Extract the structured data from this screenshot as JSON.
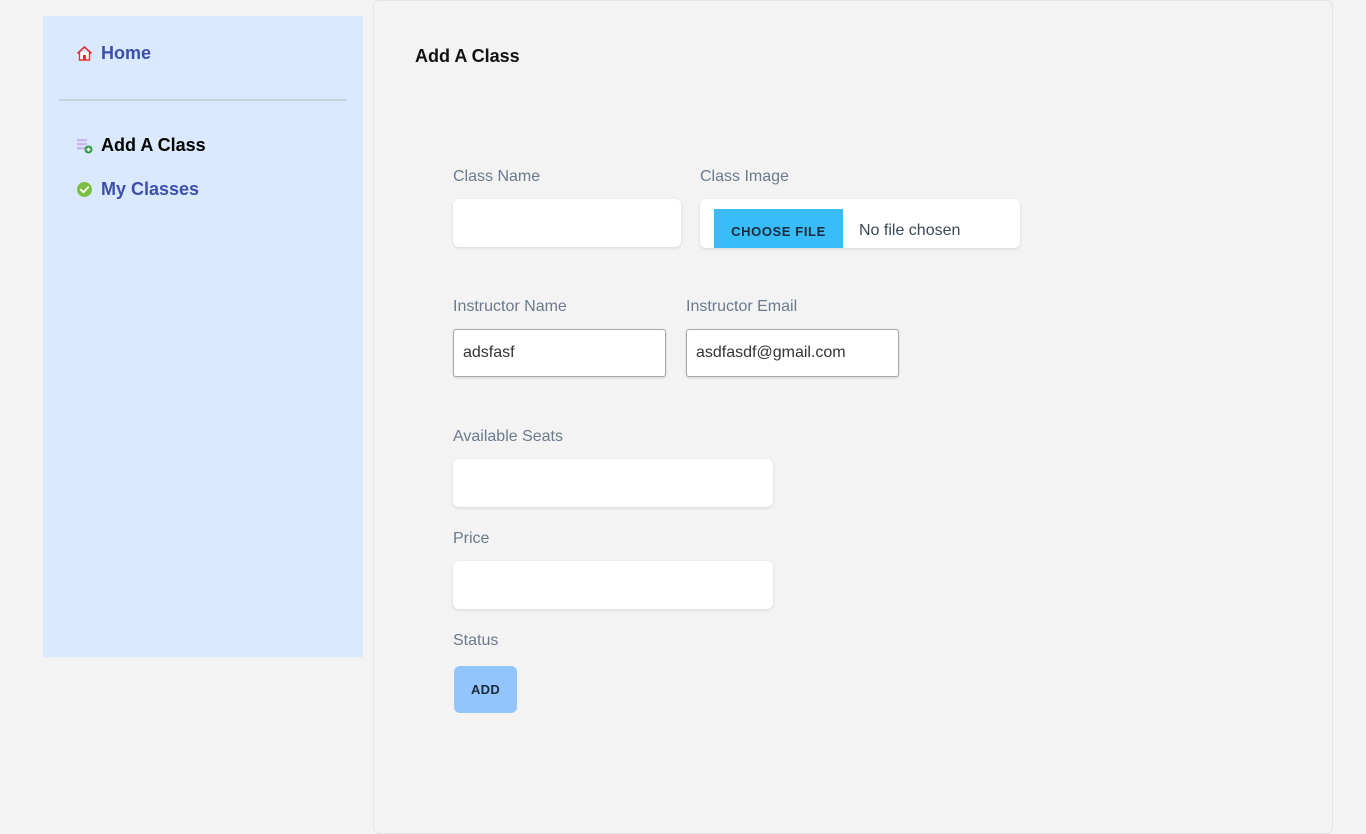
{
  "sidebar": {
    "home_label": "Home",
    "items": [
      {
        "label": "Add A Class",
        "icon": "add-list-icon"
      },
      {
        "label": "My Classes",
        "icon": "check-circle-icon"
      }
    ]
  },
  "form": {
    "title": "Add A Class",
    "class_name": {
      "label": "Class Name",
      "value": ""
    },
    "class_image": {
      "label": "Class Image",
      "button_label": "CHOOSE FILE",
      "status": "No file chosen"
    },
    "instructor_name": {
      "label": "Instructor Name",
      "value": "adsfasf"
    },
    "instructor_email": {
      "label": "Instructor Email",
      "value": "asdfasdf@gmail.com"
    },
    "available_seats": {
      "label": "Available Seats",
      "value": ""
    },
    "price": {
      "label": "Price",
      "value": ""
    },
    "status": {
      "label": "Status"
    },
    "submit_label": "ADD"
  },
  "colors": {
    "sidebar_bg": "#dbe9fe",
    "link": "#3b4fab",
    "file_button": "#38bdf8",
    "add_button": "#93c5fd"
  }
}
